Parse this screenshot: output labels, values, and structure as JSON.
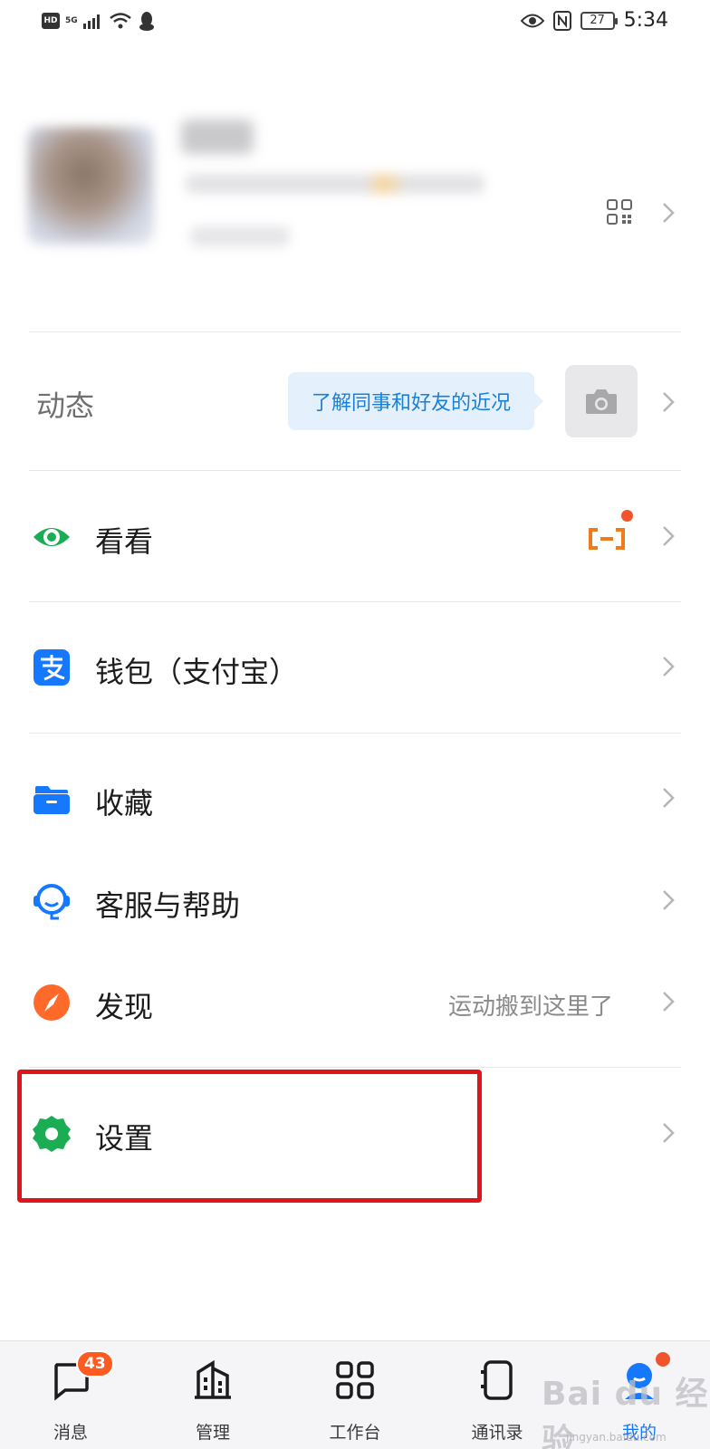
{
  "status_bar": {
    "hd": "HD",
    "network": "5G",
    "battery": "27",
    "time": "5:34"
  },
  "profile": {
    "qr_icon": "qr-code-icon"
  },
  "dynamic": {
    "label": "动态",
    "bubble_text": "了解同事和好友的近况",
    "camera_icon": "camera-icon"
  },
  "menu": {
    "kankan": {
      "label": "看看",
      "icon": "eye-icon"
    },
    "wallet": {
      "label": "钱包（支付宝）",
      "icon": "alipay-icon"
    },
    "favorites": {
      "label": "收藏",
      "icon": "folder-icon"
    },
    "support": {
      "label": "客服与帮助",
      "icon": "headset-icon"
    },
    "discover": {
      "label": "发现",
      "sub": "运动搬到这里了",
      "icon": "compass-icon"
    },
    "settings": {
      "label": "设置",
      "icon": "gear-icon"
    }
  },
  "bottom_nav": {
    "messages": {
      "label": "消息",
      "badge": "43"
    },
    "manage": {
      "label": "管理"
    },
    "workbench": {
      "label": "工作台"
    },
    "contacts": {
      "label": "通讯录"
    },
    "me": {
      "label": "我的"
    }
  },
  "watermark": {
    "text": "Bai du 经验",
    "sub": "jingyan.baidu.com"
  },
  "colors": {
    "accent_blue": "#1677ff",
    "green": "#1aad53",
    "orange": "#ff6a2b",
    "highlight_red": "#e0141b"
  }
}
